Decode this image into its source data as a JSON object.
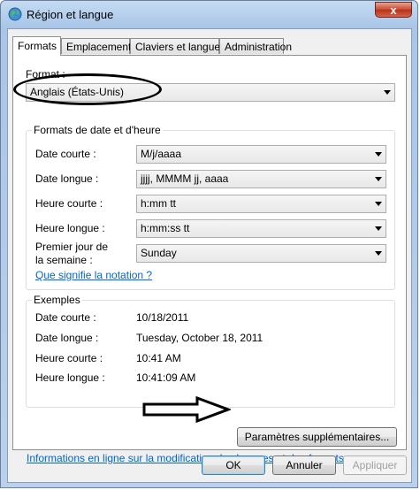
{
  "window": {
    "title": "Région et langue",
    "close_symbol": "x"
  },
  "tabs": [
    {
      "label": "Formats"
    },
    {
      "label": "Emplacement"
    },
    {
      "label": "Claviers et langues"
    },
    {
      "label": "Administration"
    }
  ],
  "format": {
    "label": "Format :",
    "value": "Anglais (États-Unis)"
  },
  "date_time_group": {
    "title": "Formats de date et d'heure",
    "rows": [
      {
        "label": "Date courte :",
        "value": "M/j/aaaa"
      },
      {
        "label": "Date longue :",
        "value": "jjjj, MMMM jj, aaaa"
      },
      {
        "label": "Heure courte :",
        "value": "h:mm tt"
      },
      {
        "label": "Heure longue :",
        "value": "h:mm:ss tt"
      },
      {
        "label_line1": "Premier jour de",
        "label_line2": "la semaine :",
        "value": "Sunday"
      }
    ],
    "notation_link": "Que signifie la notation ?"
  },
  "examples": {
    "title": "Exemples",
    "rows": [
      {
        "label": "Date courte :",
        "value": "10/18/2011"
      },
      {
        "label": "Date longue :",
        "value": "Tuesday, October 18, 2011"
      },
      {
        "label": "Heure courte :",
        "value": "10:41 AM"
      },
      {
        "label": "Heure longue :",
        "value": "10:41:09 AM"
      }
    ]
  },
  "additional_settings_button": "Paramètres supplémentaires...",
  "info_link": "Informations en ligne sur la modification des langues et des formats.",
  "footer": {
    "ok": "OK",
    "cancel": "Annuler",
    "apply": "Appliquer"
  },
  "colors": {
    "link": "#0066cc",
    "title_bar": "#a9c6e8",
    "close_button": "#c9462c"
  }
}
